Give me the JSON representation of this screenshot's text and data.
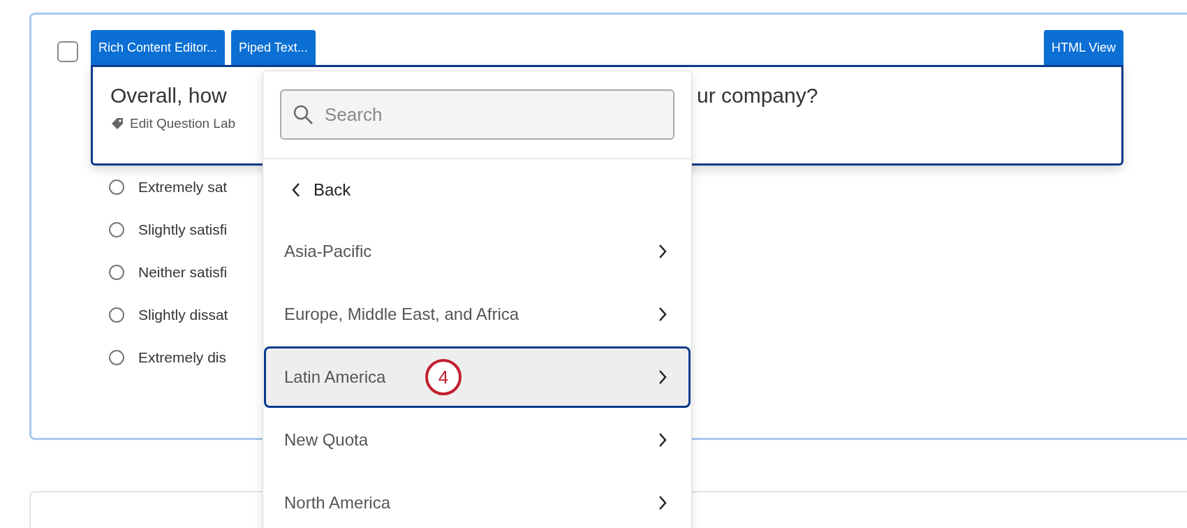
{
  "question": {
    "checkbox": {
      "checked": false
    },
    "toolbar_left": [
      {
        "label": "Rich Content Editor..."
      },
      {
        "label": "Piped Text..."
      }
    ],
    "toolbar_right": [
      {
        "label": "HTML View"
      }
    ],
    "title_parts": [
      "Overall, how",
      "ur company?"
    ],
    "label_link": "Edit Question Lab",
    "options": [
      {
        "text": "Extremely sat",
        "selected": false
      },
      {
        "text": "Slightly satisfi",
        "selected": false
      },
      {
        "text": "Neither satisfi",
        "selected": false
      },
      {
        "text": "Slightly dissat",
        "selected": false
      },
      {
        "text": "Extremely dis",
        "selected": false
      }
    ]
  },
  "dropdown": {
    "search": {
      "placeholder": "Search"
    },
    "back": "Back",
    "items": [
      {
        "label": "Asia-Pacific",
        "selected": false
      },
      {
        "label": "Europe, Middle East, and Africa",
        "selected": false
      },
      {
        "label": "Latin America",
        "selected": true,
        "callout": "4"
      },
      {
        "label": "New Quota",
        "selected": false
      },
      {
        "label": "North America",
        "selected": false
      }
    ]
  }
}
